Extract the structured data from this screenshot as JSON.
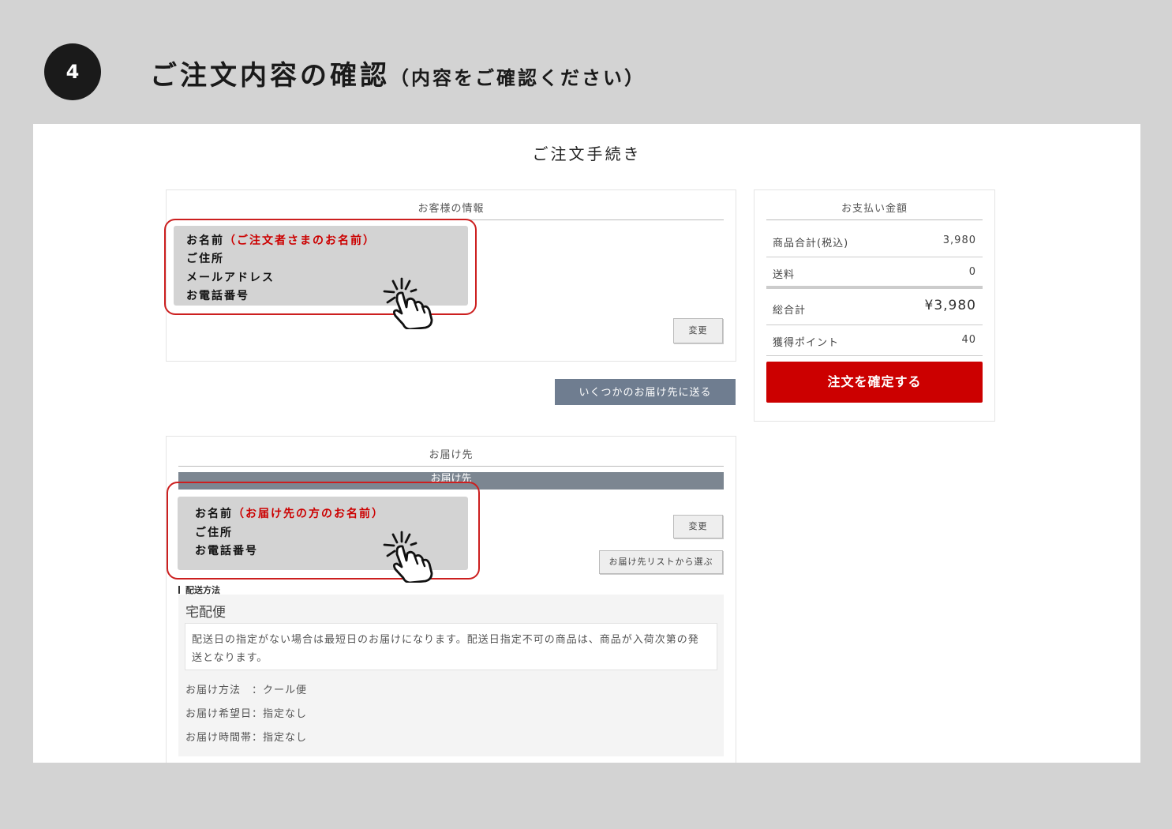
{
  "step": {
    "number": "4",
    "title": "ご注文内容の確認",
    "subtitle": "（内容をご確認ください）"
  },
  "page": {
    "title": "ご注文手続き"
  },
  "customer": {
    "heading": "お客様の情報",
    "name_label": "お名前",
    "name_note": "（ご注文者さまのお名前）",
    "address_label": "ご住所",
    "email_label": "メールアドレス",
    "phone_label": "お電話番号",
    "change_button": "変更"
  },
  "multi_ship_button": "いくつかのお届け先に送る",
  "delivery": {
    "heading": "お届け先",
    "bar_label": "お届け先",
    "name_label": "お名前",
    "name_note": "（お届け先の方のお名前）",
    "address_label": "ご住所",
    "phone_label": "お電話番号",
    "change_button": "変更",
    "list_button": "お届け先リストから選ぶ",
    "method_section": "配送方法",
    "method_name": "宅配便",
    "notice_line1": "配送日の指定がない場合は最短日のお届けになります。配送日指定不可の商品は、商品が入荷次第の発",
    "notice_line2": "送となります。",
    "method_row": "お届け方法　：クール便",
    "date_row": "お届け希望日：指定なし",
    "time_row": "お届け時間帯：指定なし"
  },
  "payment": {
    "heading": "お支払い金額",
    "subtotal_label": "商品合計(税込)",
    "subtotal_value": "3,980",
    "shipping_label": "送料",
    "shipping_value": "0",
    "total_label": "総合計",
    "total_value": "¥3,980",
    "points_label": "獲得ポイント",
    "points_value": "40",
    "confirm_button": "注文を確定する"
  },
  "colors": {
    "accent_red": "#cc0000",
    "background_gray": "#d3d3d3",
    "button_slate": "#6f7d90"
  },
  "icons": [
    "tap-hand-icon"
  ]
}
